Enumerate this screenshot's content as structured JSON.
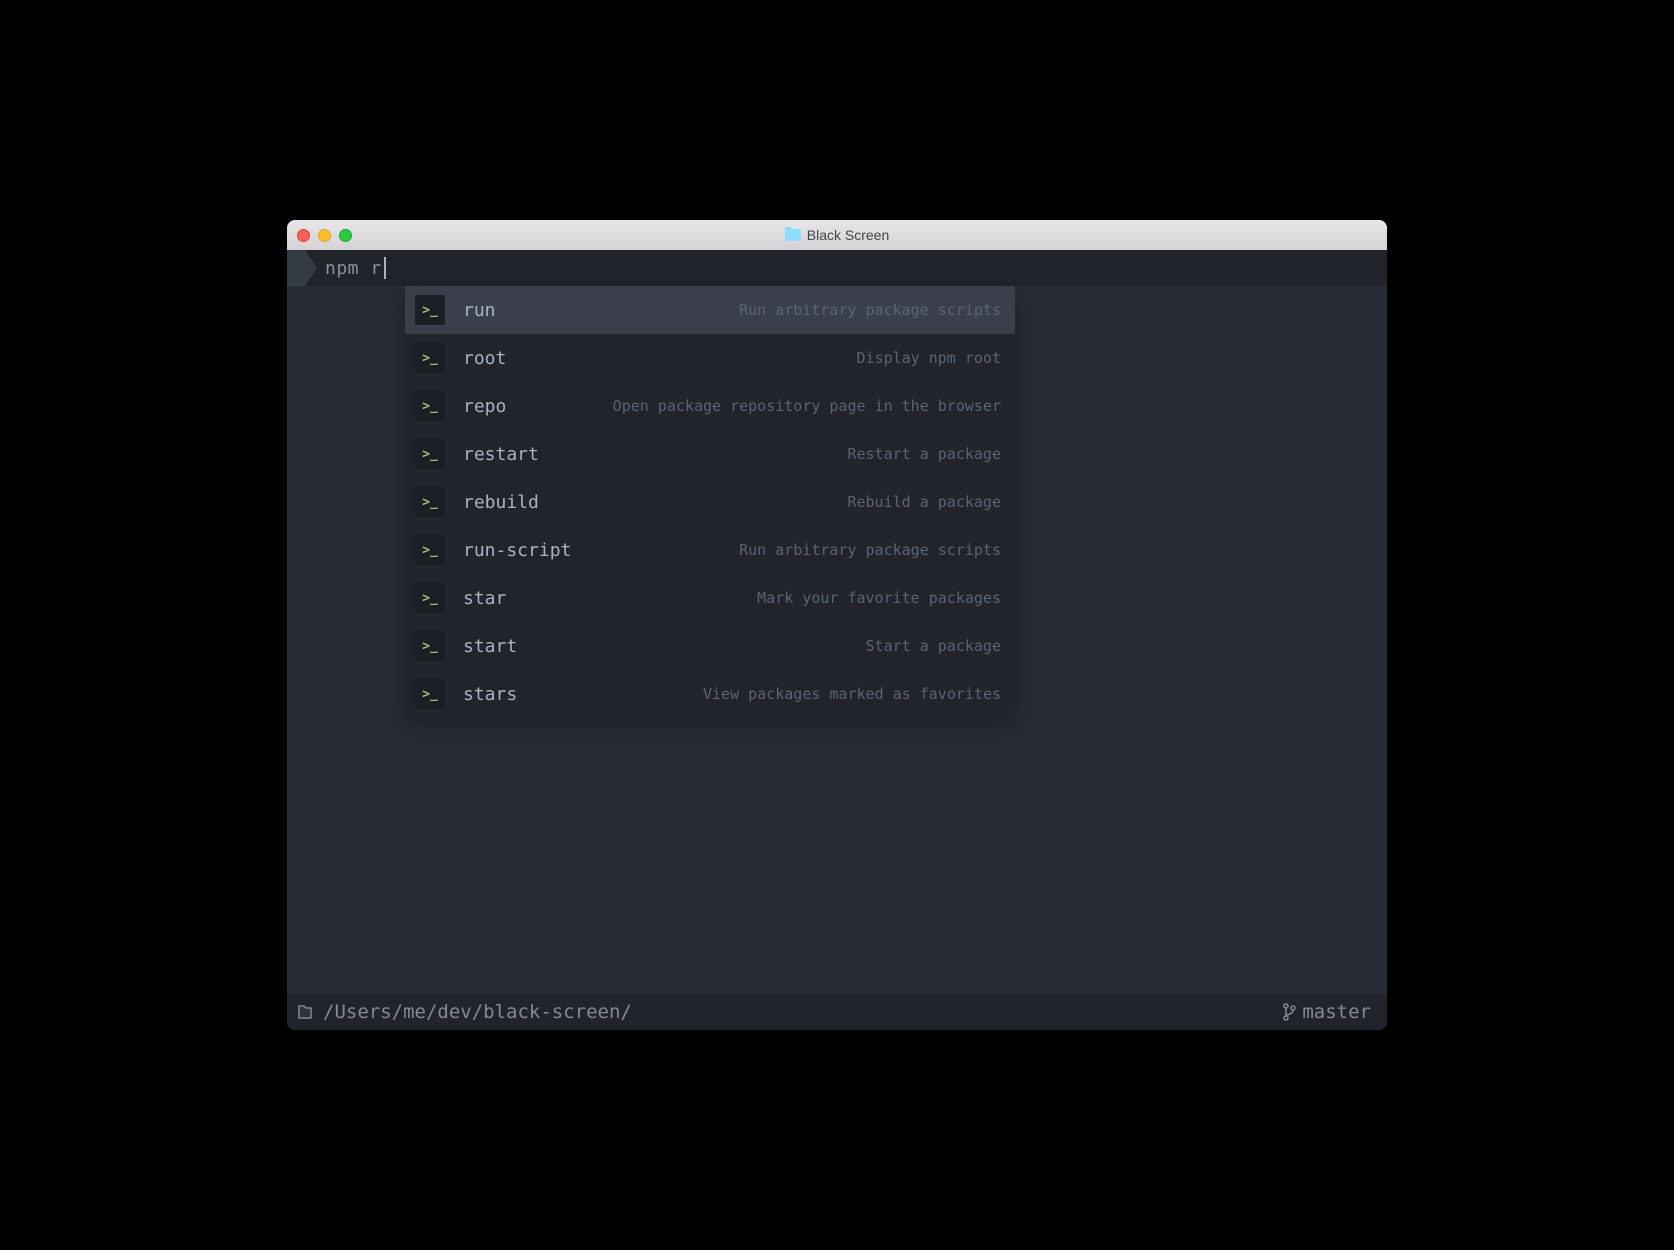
{
  "window": {
    "title": "Black Screen"
  },
  "prompt": {
    "input": "npm r"
  },
  "suggestions": [
    {
      "command": "run",
      "description": "Run arbitrary package scripts",
      "selected": true
    },
    {
      "command": "root",
      "description": "Display npm root",
      "selected": false
    },
    {
      "command": "repo",
      "description": "Open package repository page in the browser",
      "selected": false
    },
    {
      "command": "restart",
      "description": "Restart a package",
      "selected": false
    },
    {
      "command": "rebuild",
      "description": "Rebuild a package",
      "selected": false
    },
    {
      "command": "run-script",
      "description": "Run arbitrary package scripts",
      "selected": false
    },
    {
      "command": "star",
      "description": "Mark your favorite packages",
      "selected": false
    },
    {
      "command": "start",
      "description": "Start a package",
      "selected": false
    },
    {
      "command": "stars",
      "description": "View packages marked as favorites",
      "selected": false
    }
  ],
  "statusbar": {
    "cwd": "/Users/me/dev/black-screen/",
    "branch": "master"
  },
  "icons": {
    "prompt_glyph": ">_"
  }
}
